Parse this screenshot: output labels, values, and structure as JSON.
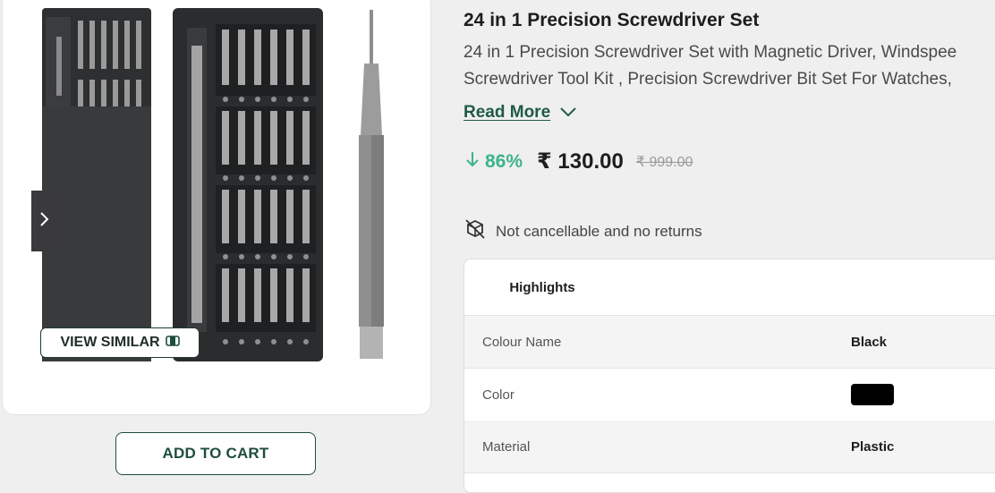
{
  "product": {
    "title": "24 in 1 Precision Screwdriver Set",
    "description_line1": "24 in 1 Precision Screwdriver Set with Magnetic Driver, Windspee",
    "description_line2": "Screwdriver Tool Kit , Precision Screwdriver Bit Set For Watches,",
    "read_more_label": "Read More"
  },
  "pricing": {
    "discount": "86%",
    "price": "₹ 130.00",
    "mrp": "₹ 999.00",
    "discount_color": "#3bb38d"
  },
  "policy": {
    "text": "Not cancellable and no returns"
  },
  "image_card": {
    "view_similar_label": "VIEW SIMILAR"
  },
  "actions": {
    "add_to_cart_label": "ADD TO CART"
  },
  "highlights": {
    "tab_label": "Highlights",
    "rows": [
      {
        "key": "Colour Name",
        "value": "Black"
      },
      {
        "key": "Color",
        "value": "",
        "swatch": "#000000"
      },
      {
        "key": "Material",
        "value": "Plastic"
      }
    ]
  },
  "icons": {
    "carousel_next": "chevron-right-icon",
    "read_more": "chevron-down-icon",
    "discount": "arrow-down-icon",
    "policy": "no-return-box-icon",
    "view_similar": "similar-icon"
  },
  "colors": {
    "brand": "#1f4d40",
    "accent": "#3bb38d"
  }
}
